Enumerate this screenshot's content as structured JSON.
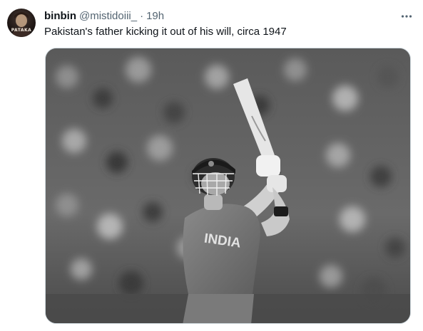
{
  "author": {
    "display_name": "binbin",
    "handle": "@mistidoiii_",
    "separator": "·",
    "time": "19h",
    "avatar_text": "PATAKA"
  },
  "tweet": {
    "text": "Pakistan's father kicking it out of his will, circa 1947"
  },
  "media": {
    "jersey_text": "INDIA"
  },
  "icons": {
    "more": "more-horizontal-icon"
  }
}
